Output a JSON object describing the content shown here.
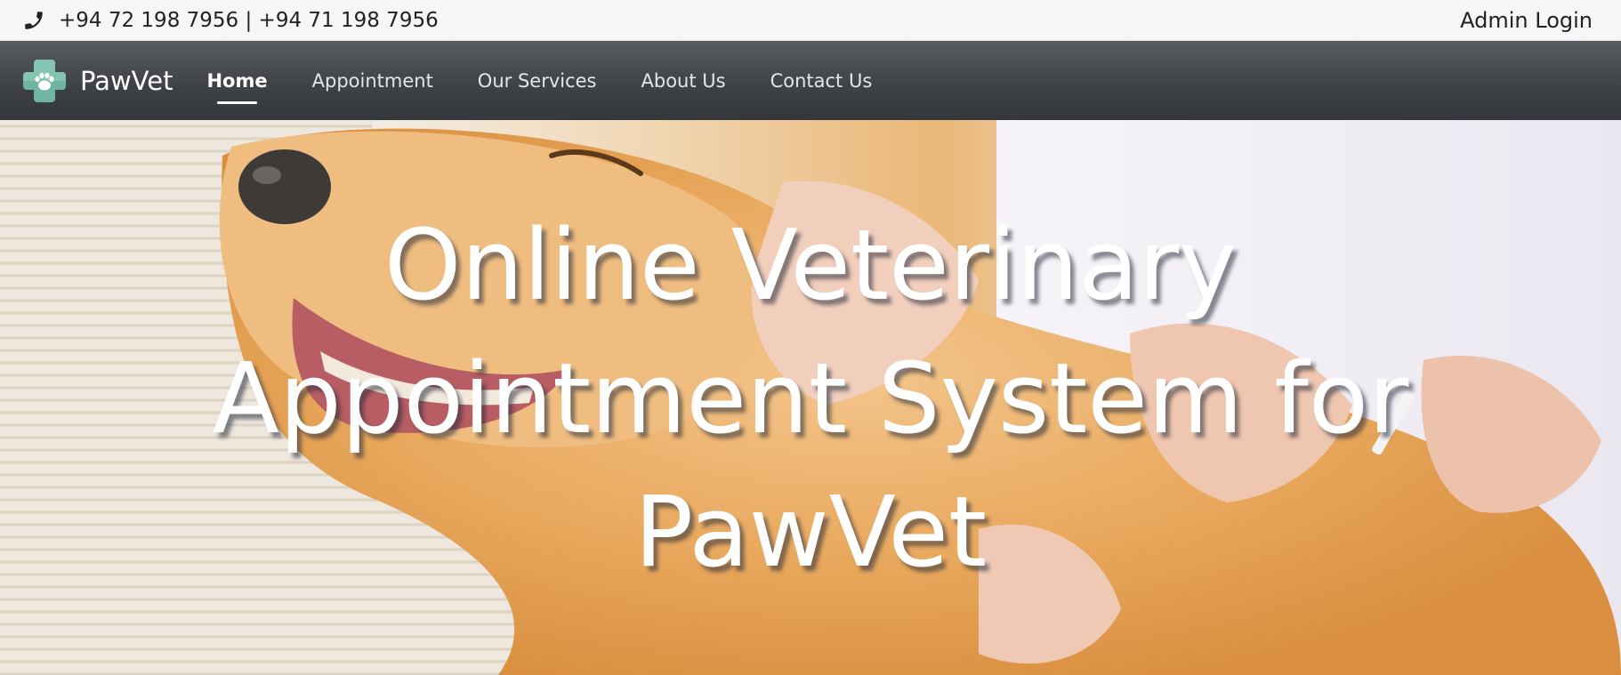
{
  "topbar": {
    "phone_icon": "phone-icon",
    "phones": "+94 72 198 7956 | +94 71 198 7956",
    "admin_login": "Admin Login"
  },
  "navbar": {
    "brand_icon": "paw-cross-logo-icon",
    "brand_name": "PawVet",
    "links": [
      {
        "label": "Home",
        "active": true
      },
      {
        "label": "Appointment",
        "active": false
      },
      {
        "label": "Our Services",
        "active": false
      },
      {
        "label": "About Us",
        "active": false
      },
      {
        "label": "Contact Us",
        "active": false
      }
    ]
  },
  "hero": {
    "title": "Online Veterinary Appointment System for PawVet",
    "image_subject": "golden-retriever-vet-exam-photo"
  },
  "colors": {
    "navbar": "#3f4246",
    "topbar": "#f5f6f8",
    "brand_accent": "#6fb5a1",
    "hero_text": "#ffffff"
  }
}
